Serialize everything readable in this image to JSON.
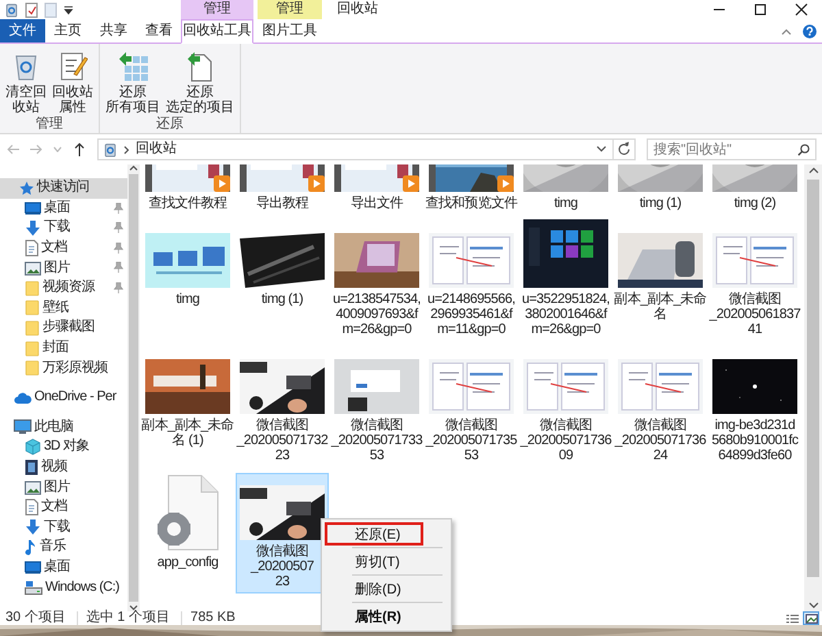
{
  "window": {
    "title": "回收站"
  },
  "context_tabs": [
    {
      "label": "管理",
      "color": "#e6c6f5"
    },
    {
      "label": "管理",
      "color": "#f2f09a"
    }
  ],
  "tabs": [
    {
      "label": "文件",
      "kind": "file",
      "selected": false
    },
    {
      "label": "主页",
      "kind": "plain",
      "selected": false
    },
    {
      "label": "共享",
      "kind": "plain",
      "selected": false
    },
    {
      "label": "查看",
      "kind": "plain",
      "selected": false
    },
    {
      "label": "回收站工具",
      "kind": "context",
      "selected": true
    },
    {
      "label": "图片工具",
      "kind": "context",
      "selected": false
    }
  ],
  "ribbon": {
    "groups": [
      {
        "label": "管理",
        "buttons": [
          {
            "kind": "empty-bin",
            "lines": [
              "清空回",
              "收站"
            ]
          },
          {
            "kind": "properties",
            "lines": [
              "回收站",
              "属性"
            ]
          }
        ]
      },
      {
        "label": "还原",
        "buttons": [
          {
            "kind": "restore-all",
            "lines": [
              "还原",
              "所有项目"
            ]
          },
          {
            "kind": "restore-selected",
            "lines": [
              "还原",
              "选定的项目"
            ]
          }
        ]
      }
    ]
  },
  "address": {
    "location": "回收站"
  },
  "search": {
    "placeholder": "搜索\"回收站\""
  },
  "sidebar": {
    "items": [
      {
        "label": "快速访问",
        "kind": "star",
        "selected": true,
        "children": [
          {
            "label": "桌面",
            "kind": "desktop",
            "pinned": true
          },
          {
            "label": "下载",
            "kind": "download",
            "pinned": true
          },
          {
            "label": "文档",
            "kind": "document",
            "pinned": true
          },
          {
            "label": "图片",
            "kind": "pictures",
            "pinned": true
          },
          {
            "label": "视频资源",
            "kind": "folder",
            "pinned": true
          },
          {
            "label": "壁纸",
            "kind": "folder",
            "pinned": false
          },
          {
            "label": "步骤截图",
            "kind": "folder",
            "pinned": false
          },
          {
            "label": "封面",
            "kind": "folder",
            "pinned": false
          },
          {
            "label": "万彩原视频",
            "kind": "folder",
            "pinned": false
          }
        ]
      },
      {
        "label": "OneDrive - Per",
        "kind": "cloud",
        "selected": false
      },
      {
        "label": "此电脑",
        "kind": "pc",
        "selected": false,
        "children": [
          {
            "label": "3D 对象",
            "kind": "cube"
          },
          {
            "label": "视频",
            "kind": "video"
          },
          {
            "label": "图片",
            "kind": "pictures"
          },
          {
            "label": "文档",
            "kind": "document"
          },
          {
            "label": "下载",
            "kind": "download"
          },
          {
            "label": "音乐",
            "kind": "music"
          },
          {
            "label": "桌面",
            "kind": "desktop"
          },
          {
            "label": "Windows (C:)",
            "kind": "drive"
          }
        ]
      }
    ]
  },
  "files": [
    {
      "kind": "video",
      "lines": [
        "查找文件教程"
      ],
      "selected": false
    },
    {
      "kind": "video",
      "lines": [
        "导出教程"
      ],
      "selected": false
    },
    {
      "kind": "video",
      "lines": [
        "导出文件"
      ],
      "selected": false
    },
    {
      "kind": "video",
      "lines": [
        "查找和预览文件"
      ],
      "selected": false
    },
    {
      "lines": [
        "timg"
      ],
      "selected": false
    },
    {
      "lines": [
        "timg (1)"
      ],
      "selected": false
    },
    {
      "lines": [
        "timg (2)"
      ],
      "selected": false
    },
    {
      "lines": [
        "timg"
      ],
      "selected": false
    },
    {
      "lines": [
        "timg (1)"
      ],
      "selected": false
    },
    {
      "lines": [
        "u=2138547534,",
        "4009097693&f",
        "m=26&gp=0"
      ],
      "selected": false
    },
    {
      "lines": [
        "u=2148695566,",
        "2969935461&f",
        "m=11&gp=0"
      ],
      "selected": false
    },
    {
      "lines": [
        "u=3522951824,",
        "3802001646&f",
        "m=26&gp=0"
      ],
      "selected": false
    },
    {
      "lines": [
        "副本_副本_未命",
        "名"
      ],
      "selected": false
    },
    {
      "lines": [
        "微信截图",
        "_202005061837",
        "41"
      ],
      "selected": false
    },
    {
      "lines": [
        "副本_副本_未命",
        "名 (1)"
      ],
      "selected": false
    },
    {
      "lines": [
        "微信截图",
        "_202005071732",
        "23"
      ],
      "selected": false
    },
    {
      "lines": [
        "微信截图",
        "_202005071733",
        "53"
      ],
      "selected": false
    },
    {
      "lines": [
        "微信截图",
        "_202005071735",
        "53"
      ],
      "selected": false
    },
    {
      "lines": [
        "微信截图",
        "_202005071736",
        "09"
      ],
      "selected": false
    },
    {
      "lines": [
        "微信截图",
        "_202005071736",
        "24"
      ],
      "selected": false
    },
    {
      "lines": [
        "img-be3d231d",
        "5680b910001fc",
        "64899d3fe60"
      ],
      "selected": false
    },
    {
      "kind": "document",
      "lines": [
        "app_config"
      ],
      "selected": false
    },
    {
      "lines": [
        "微信截图",
        "_20200507",
        "23"
      ],
      "selected": true
    }
  ],
  "context_menu": [
    {
      "label": "还原(E)",
      "highlighted": true,
      "bold": false
    },
    {
      "label": "剪切(T)",
      "highlighted": false,
      "bold": false
    },
    {
      "label": "删除(D)",
      "highlighted": false,
      "bold": false
    },
    {
      "label": "属性(R)",
      "highlighted": false,
      "bold": true
    }
  ],
  "status_bar": {
    "count": "30 个项目",
    "selection": "选中 1 个项目",
    "size": "785 KB"
  },
  "view_buttons": [
    {
      "kind": "details",
      "selected": false
    },
    {
      "kind": "large-icons",
      "selected": true
    }
  ]
}
